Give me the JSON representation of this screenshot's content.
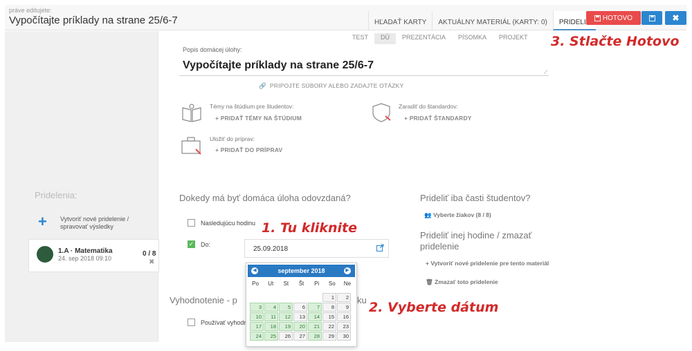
{
  "header": {
    "editing_label": "práve editujete:",
    "title": "Vypočítajte príklady na strane 25/6-7",
    "tabs": [
      "HĽADAŤ KARTY",
      "AKTUÁLNY MATERIÁL (KARTY: 0)",
      "PRIDELIŤ"
    ],
    "done_label": "HOTOVO",
    "close_label": "✖"
  },
  "type_tabs": [
    "TEST",
    "DÚ",
    "PREZENTÁCIA",
    "PÍSOMKA",
    "PROJEKT"
  ],
  "sidebar": {
    "heading": "Pridelenia:",
    "new_assignment": "Vytvoriť nové pridelenie / spravovať výsledky",
    "class": {
      "name": "1.A · Matematika",
      "date": "24. sep 2018 09:10",
      "count": "0 / 8",
      "remove": "✖"
    }
  },
  "main": {
    "desc_label": "Popis domácej úlohy:",
    "homework_title": "Vypočítajte príklady na strane 25/6-7",
    "attach": "PRIPOJTE SÚBORY ALEBO ZADAJTE OTÁZKY",
    "topics_label": "Témy na štúdium pre študentov:",
    "topics_action": "+ PRIDAŤ TÉMY NA ŠTÚDIUM",
    "standards_label": "Zaradiť do štandardov:",
    "standards_action": "+ PRIDAŤ ŠTANDARDY",
    "prep_label": "Uložiť do príprav:",
    "prep_action": "+ PRIDAŤ DO PRÍPRAV",
    "deadline_heading": "Dokedy má byť domáca úloha odovzdaná?",
    "next_lesson": "Nasledujúcu hodinu",
    "until_label": "Do:",
    "date_value": "25.09.2018",
    "evaluation_heading": "Vyhodnotenie - p",
    "evaluation_tail": "ku",
    "use_evaluation": "Používať vyhodno"
  },
  "side_panel": {
    "students_heading": "Prideliť iba časti študentov?",
    "select_students": "Vyberte žiakov (8 / 8)",
    "other_class_heading": "Prideliť inej hodine / zmazať pridelenie",
    "create_new": "+ Vytvoriť nové pridelenie pre tento materiál",
    "delete": "Zmazať toto pridelenie"
  },
  "calendar": {
    "month": "september 2018",
    "weekdays": [
      "Po",
      "Ut",
      "St",
      "Št",
      "Pi",
      "So",
      "Ne"
    ],
    "weeks": [
      [
        "",
        "",
        "",
        "",
        "",
        "1",
        "2"
      ],
      [
        "3",
        "4",
        "5",
        "6",
        "7",
        "8",
        "9"
      ],
      [
        "10",
        "11",
        "12",
        "13",
        "14",
        "15",
        "16"
      ],
      [
        "17",
        "18",
        "19",
        "20",
        "21",
        "22",
        "23"
      ],
      [
        "24",
        "25",
        "26",
        "27",
        "28",
        "29",
        "30"
      ]
    ]
  },
  "annotations": {
    "step1": "1. Tu kliknite",
    "step2": "2. Vyberte dátum",
    "step3": "3. Stlačte Hotovo"
  },
  "colors": {
    "accent": "#2b86d0",
    "done": "#e94b4b",
    "annotation": "#d22a2a",
    "calendar_green": "#d9efd9"
  }
}
